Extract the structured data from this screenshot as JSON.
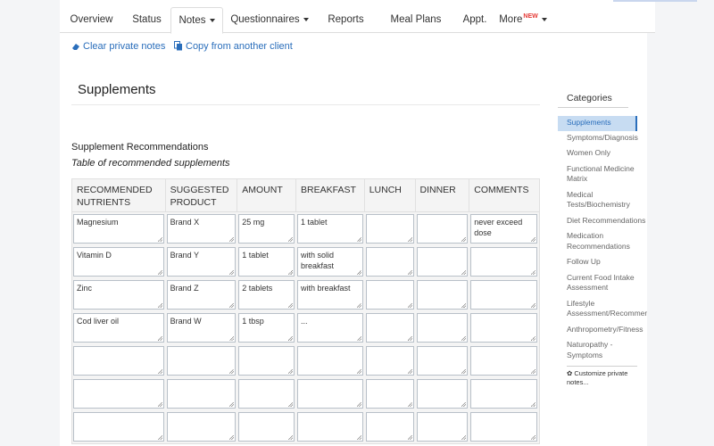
{
  "tabs": [
    {
      "label": "Overview",
      "active": false,
      "caret": false
    },
    {
      "label": "Status",
      "active": false,
      "caret": false
    },
    {
      "label": "Notes",
      "active": true,
      "caret": true
    },
    {
      "label": "Questionnaires",
      "active": false,
      "caret": true
    },
    {
      "label": "Reports",
      "active": false,
      "caret": false
    },
    {
      "label": "Meal Plans",
      "active": false,
      "caret": false
    },
    {
      "label": "Appt.",
      "active": false,
      "caret": false
    },
    {
      "label": "More",
      "active": false,
      "caret": true,
      "badge": "NEW"
    }
  ],
  "actions": {
    "clear_label": "Clear private notes",
    "copy_label": "Copy from another client"
  },
  "section": {
    "title": "Supplements",
    "subtitle": "Supplement Recommendations",
    "description": "Table of recommended supplements"
  },
  "table": {
    "headers": [
      "RECOMMENDED NUTRIENTS",
      "SUGGESTED PRODUCT",
      "AMOUNT",
      "BREAKFAST",
      "LUNCH",
      "DINNER",
      "COMMENTS"
    ],
    "rows": [
      [
        "Magnesium",
        "Brand X",
        "25 mg",
        "1 tablet",
        "",
        "",
        "never exceed dose"
      ],
      [
        "Vitamin D",
        "Brand Y",
        "1 tablet",
        "with solid breakfast",
        "",
        "",
        ""
      ],
      [
        "Zinc",
        "Brand Z",
        "2 tablets",
        "with breakfast",
        "",
        "",
        ""
      ],
      [
        "Cod liver oil",
        "Brand W",
        "1 tbsp",
        "...",
        "",
        "",
        ""
      ],
      [
        "",
        "",
        "",
        "",
        "",
        "",
        ""
      ],
      [
        "",
        "",
        "",
        "",
        "",
        "",
        ""
      ],
      [
        "",
        "",
        "",
        "",
        "",
        "",
        ""
      ]
    ]
  },
  "sidebar": {
    "heading": "Categories",
    "items": [
      {
        "label": "Supplements",
        "active": true
      },
      {
        "label": "Symptoms/Diagnosis",
        "active": false
      },
      {
        "label": "Women Only",
        "active": false
      },
      {
        "label": "Functional Medicine Matrix",
        "active": false
      },
      {
        "label": "Medical Tests/Biochemistry",
        "active": false
      },
      {
        "label": "Diet Recommendations",
        "active": false
      },
      {
        "label": "Medication Recommendations",
        "active": false
      },
      {
        "label": "Follow Up",
        "active": false
      },
      {
        "label": "Current Food Intake Assessment",
        "active": false
      },
      {
        "label": "Lifestyle Assessment/Recommendations",
        "active": false
      },
      {
        "label": "Anthropometry/Fitness",
        "active": false
      },
      {
        "label": "Naturopathy - Symptoms",
        "active": false
      }
    ],
    "customize_label": "Customize private notes..."
  },
  "colors": {
    "link": "#2a6ebb",
    "active_category_bg": "#c7dcf2",
    "badge": "#e53935"
  }
}
